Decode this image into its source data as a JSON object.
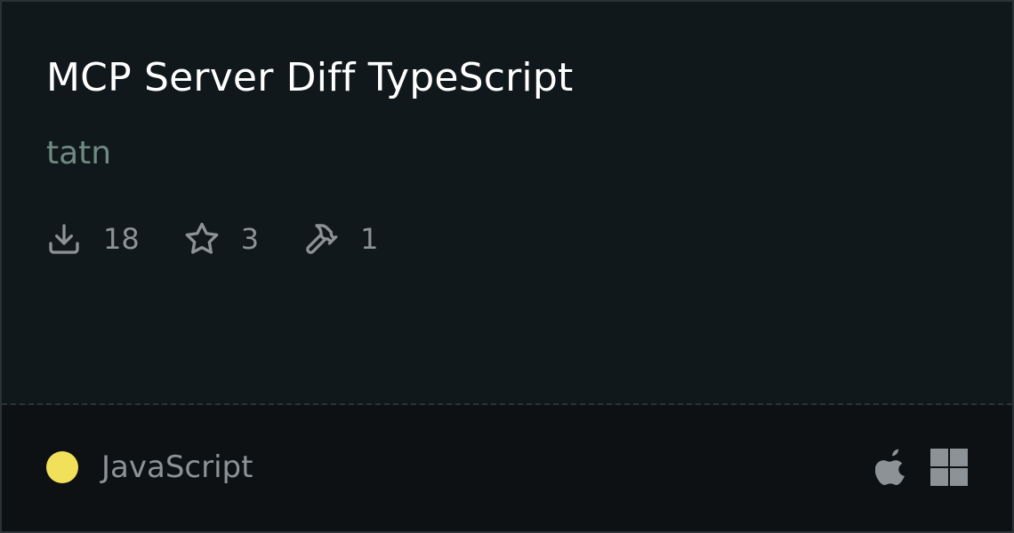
{
  "card": {
    "title": "MCP Server Diff TypeScript",
    "author": "tatn",
    "stats": {
      "downloads": "18",
      "stars": "3",
      "tools": "1"
    },
    "language": {
      "name": "JavaScript",
      "color": "#f1e05a"
    },
    "platforms": [
      "apple-icon",
      "windows-icon"
    ]
  },
  "icons": {
    "download": "download-icon",
    "star": "star-icon",
    "tools": "hammer-icon"
  },
  "colors": {
    "background": "#11181b",
    "footer": "#0d1114",
    "title": "#ffffff",
    "author": "#6f8a82",
    "muted": "#8c9296",
    "border": "#2b3236"
  }
}
